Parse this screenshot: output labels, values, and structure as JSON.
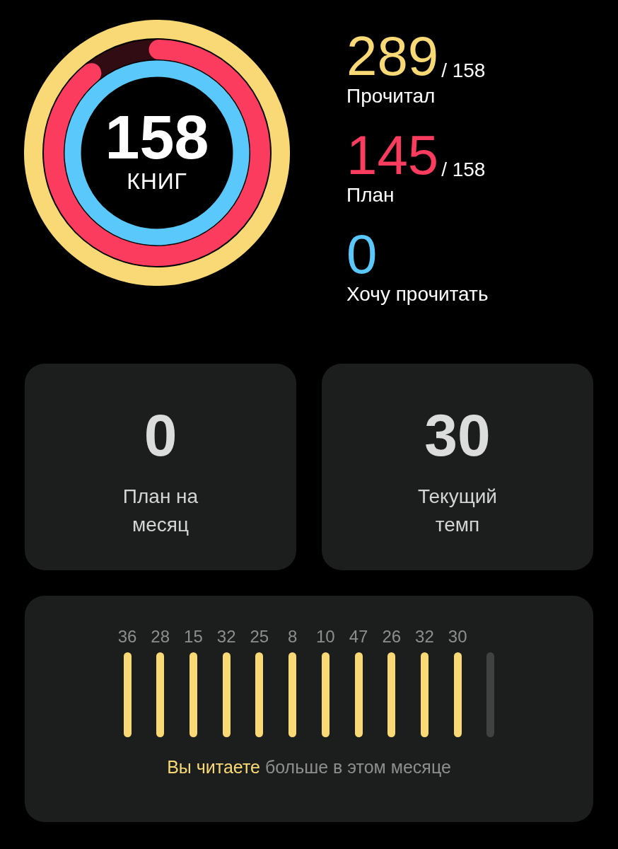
{
  "rings": [
    {
      "kind": "read",
      "color": "#f9d976",
      "level": 1
    },
    {
      "kind": "plan",
      "color": "#fb3c5f",
      "level": 0.918
    },
    {
      "kind": "want",
      "color": "#5ac8fb",
      "level": 1
    }
  ],
  "center": {
    "value": "158",
    "unit": "КНИГ"
  },
  "stats": [
    {
      "value": "289",
      "total": "/ 158",
      "label": "Прочитал",
      "color": "#f9d976"
    },
    {
      "value": "145",
      "total": "/ 158",
      "label": "План",
      "color": "#fb3c5f"
    },
    {
      "value": "0",
      "label": "Хочу прочитать",
      "color": "#5ac8fb"
    }
  ],
  "cards": [
    {
      "value": "0",
      "label": "План на\nмесяц"
    },
    {
      "value": "30",
      "label": "Текущий\nтемп"
    }
  ],
  "months": [
    {
      "label": "36",
      "filled": true
    },
    {
      "label": "28",
      "filled": true
    },
    {
      "label": "15",
      "filled": true
    },
    {
      "label": "32",
      "filled": true
    },
    {
      "label": "25",
      "filled": true
    },
    {
      "label": "8",
      "filled": true
    },
    {
      "label": "10",
      "filled": true
    },
    {
      "label": "47",
      "filled": true
    },
    {
      "label": "26",
      "filled": true
    },
    {
      "label": "32",
      "filled": true
    },
    {
      "label": "30",
      "filled": true
    },
    {
      "filled": false
    }
  ],
  "caption": "**Вы читаете** больше в этом месяце"
}
